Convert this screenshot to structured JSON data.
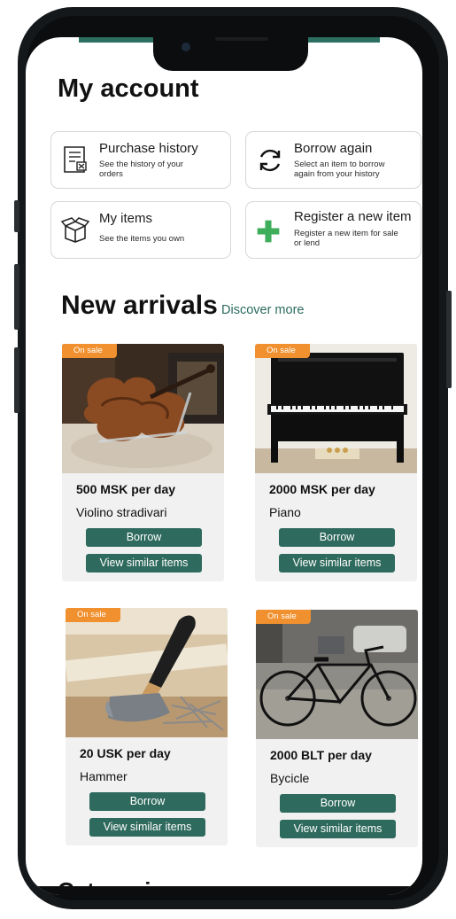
{
  "page": {
    "title": "My account"
  },
  "tiles": [
    {
      "name": "Purchase history",
      "desc": "See the history of your orders",
      "icon": "receipt-icon"
    },
    {
      "name": "Borrow again",
      "desc": "Select an item to borrow again from your history",
      "icon": "refresh-icon"
    },
    {
      "name": "My items",
      "desc": "See the items you own",
      "icon": "box-icon"
    },
    {
      "name": "Register a new item",
      "desc": "Register a new item for sale or lend",
      "icon": "plus-icon"
    }
  ],
  "arrivals": {
    "title": "New arrivals",
    "discover": "Discover more",
    "items": [
      {
        "badge": "On sale",
        "price": "500 MSK per day",
        "name": "Violino stradivari",
        "borrow": "Borrow",
        "similar": "View similar items",
        "image": "violin-image"
      },
      {
        "badge": "On sale",
        "price": "2000 MSK per day",
        "name": "Piano",
        "borrow": "Borrow",
        "similar": "View similar items",
        "image": "piano-image"
      },
      {
        "badge": "On sale",
        "price": "20 USK per day",
        "name": "Hammer",
        "borrow": "Borrow",
        "similar": "View similar items",
        "image": "hammer-image"
      },
      {
        "badge": "On sale",
        "price": "2000 BLT per day",
        "name": "Bycicle",
        "borrow": "Borrow",
        "similar": "View similar items",
        "image": "bicycle-image"
      }
    ]
  },
  "categories": {
    "title": "Categories"
  },
  "colors": {
    "accent": "#2e6a5d",
    "badge": "#f0902e",
    "plus": "#3fae5a"
  }
}
